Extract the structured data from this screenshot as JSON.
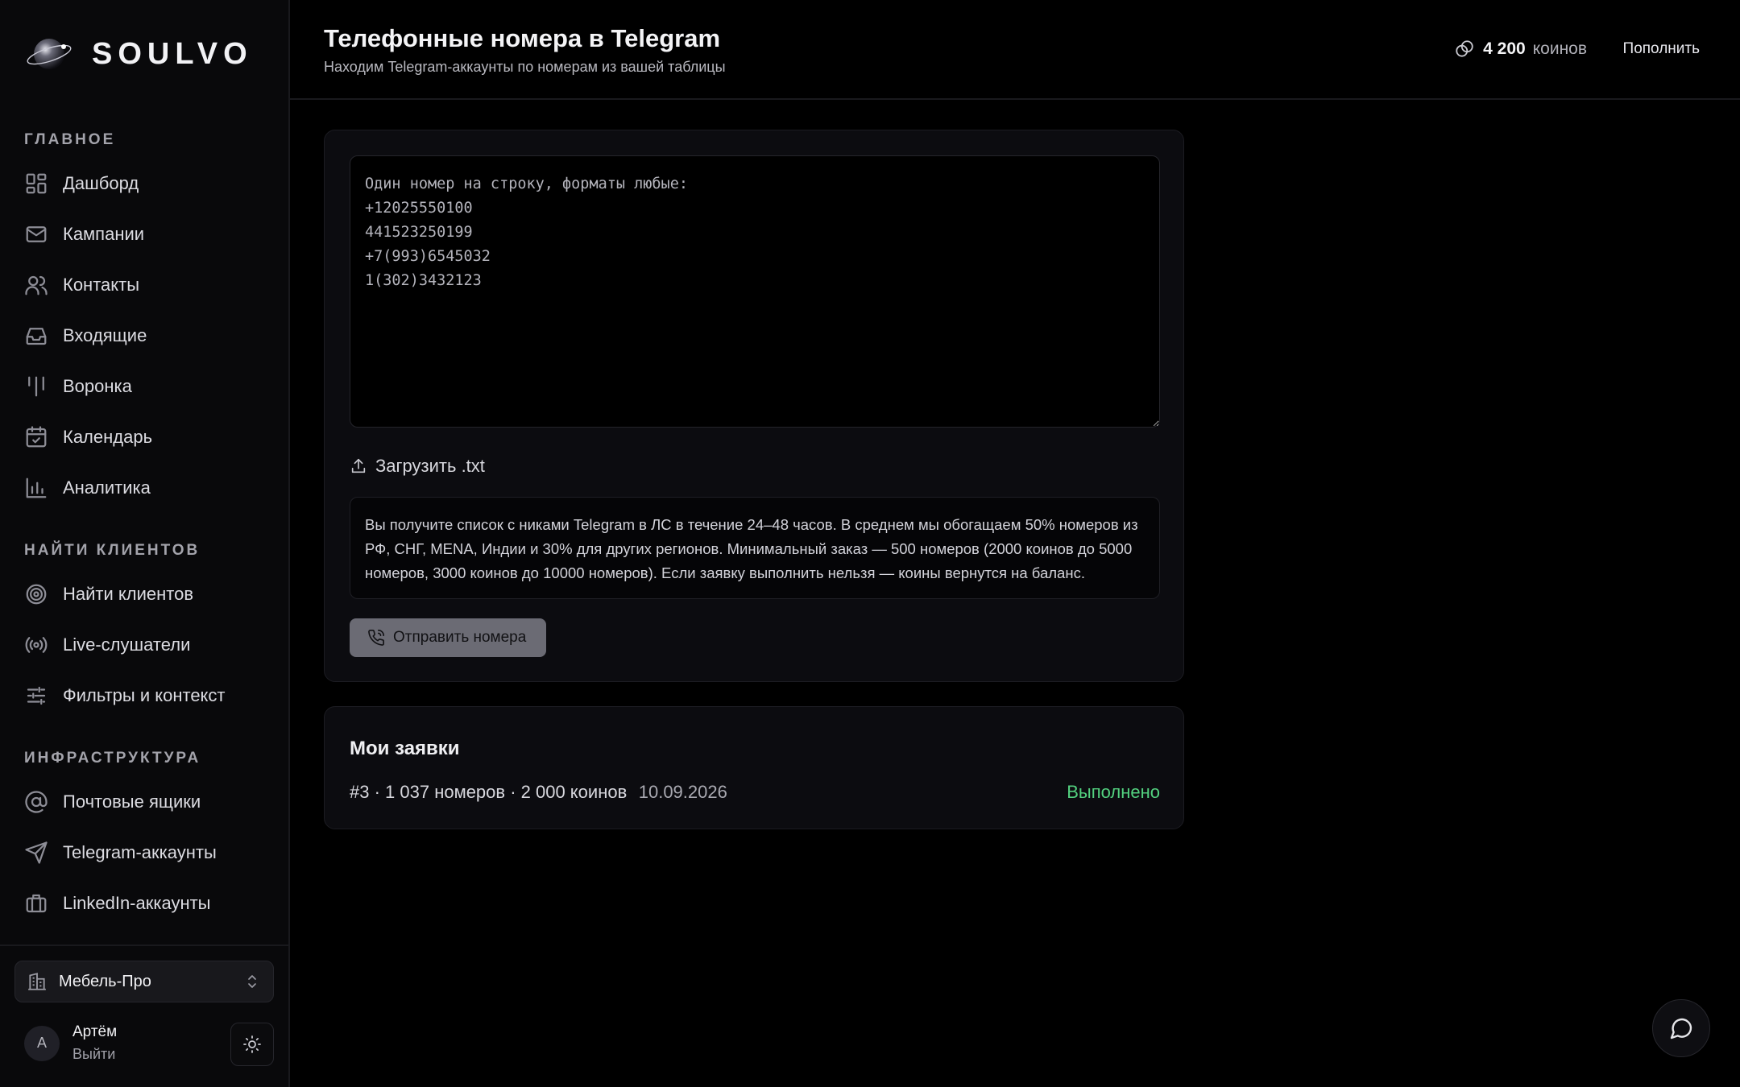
{
  "brand": {
    "name": "SOULVO"
  },
  "sidebar": {
    "sections": [
      {
        "title": "ГЛАВНОЕ",
        "items": [
          {
            "label": "Дашборд",
            "icon": "dashboard-icon"
          },
          {
            "label": "Кампании",
            "icon": "mail-icon"
          },
          {
            "label": "Контакты",
            "icon": "users-icon"
          },
          {
            "label": "Входящие",
            "icon": "inbox-icon"
          },
          {
            "label": "Воронка",
            "icon": "funnel-icon"
          },
          {
            "label": "Календарь",
            "icon": "calendar-icon"
          },
          {
            "label": "Аналитика",
            "icon": "bar-chart-icon"
          }
        ]
      },
      {
        "title": "НАЙТИ КЛИЕНТОВ",
        "items": [
          {
            "label": "Найти клиентов",
            "icon": "target-icon"
          },
          {
            "label": "Live-слушатели",
            "icon": "radio-icon"
          },
          {
            "label": "Фильтры и контекст",
            "icon": "sliders-icon"
          }
        ]
      },
      {
        "title": "ИНФРАСТРУКТУРА",
        "items": [
          {
            "label": "Почтовые ящики",
            "icon": "at-sign-icon"
          },
          {
            "label": "Telegram-аккаунты",
            "icon": "send-icon"
          },
          {
            "label": "LinkedIn-аккаунты",
            "icon": "briefcase-icon"
          }
        ]
      }
    ],
    "workspace": {
      "name": "Мебель-Про"
    },
    "user": {
      "initial": "А",
      "name": "Артём",
      "logout": "Выйти"
    }
  },
  "header": {
    "title": "Телефонные номера в Telegram",
    "subtitle": "Находим Telegram-аккаунты по номерам из вашей таблицы",
    "balance_value": "4 200",
    "balance_unit": "коинов",
    "topup_label": "Пополнить"
  },
  "upload_form": {
    "textarea_placeholder": "Один номер на строку, форматы любые:\n+12025550100\n441523250199\n+7(993)6545032\n1(302)3432123",
    "upload_label": "Загрузить .txt",
    "notice": "Вы получите список с никами Telegram в ЛС в течение 24–48 часов. В среднем мы обогащаем 50% номеров из РФ, СНГ, MENA, Индии и 30% для других регионов. Минимальный заказ — 500 номеров (2000 коинов до 5000 номеров, 3000 коинов до 10000 номеров). Если заявку выполнить нельзя — коины вернутся на баланс.",
    "submit_label": "Отправить номера"
  },
  "orders": {
    "title": "Мои заявки",
    "items": [
      {
        "summary": "#3 · 1 037 номеров · 2 000 коинов",
        "date": "10.09.2026",
        "status": "Выполнено"
      }
    ]
  },
  "colors": {
    "status_done": "#53d17f",
    "accent_button": "#6b6b74"
  }
}
